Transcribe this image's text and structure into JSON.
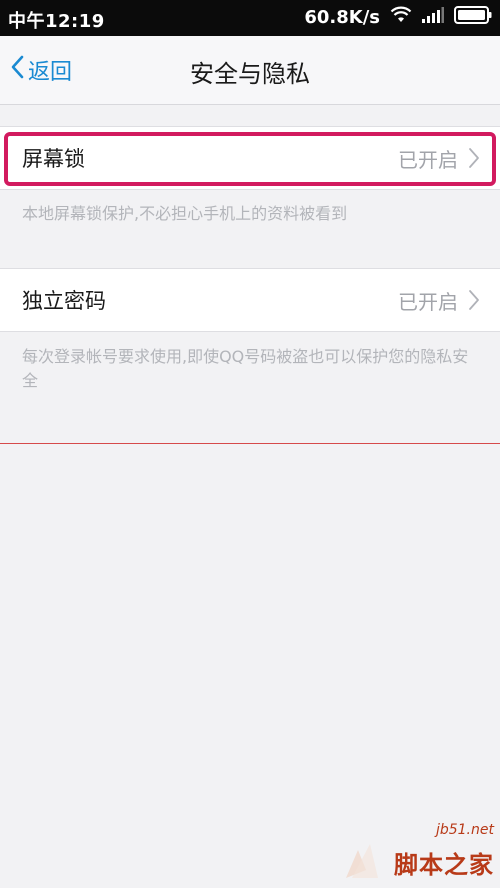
{
  "status_bar": {
    "time": "中午12:19",
    "network_speed": "60.8K/s",
    "icons": [
      "wifi-icon",
      "signal-icon",
      "battery-icon"
    ]
  },
  "nav": {
    "back_label": "返回",
    "title": "安全与隐私"
  },
  "settings": [
    {
      "label": "屏幕锁",
      "status": "已开启",
      "hint": "本地屏幕锁保护,不必担心手机上的资料被看到",
      "highlighted": true
    },
    {
      "label": "独立密码",
      "status": "已开启",
      "hint": "每次登录帐号要求使用,即使QQ号码被盗也可以保护您的隐私安全",
      "highlighted": false
    }
  ],
  "watermark": {
    "site": "jb51.net",
    "brand": "脚本之家"
  },
  "colors": {
    "accent": "#1a8ad2",
    "highlight": "#d21a5f",
    "status_text": "#a2a4aa",
    "hint_text": "#b3b5ba",
    "watermark": "#b83a18"
  }
}
